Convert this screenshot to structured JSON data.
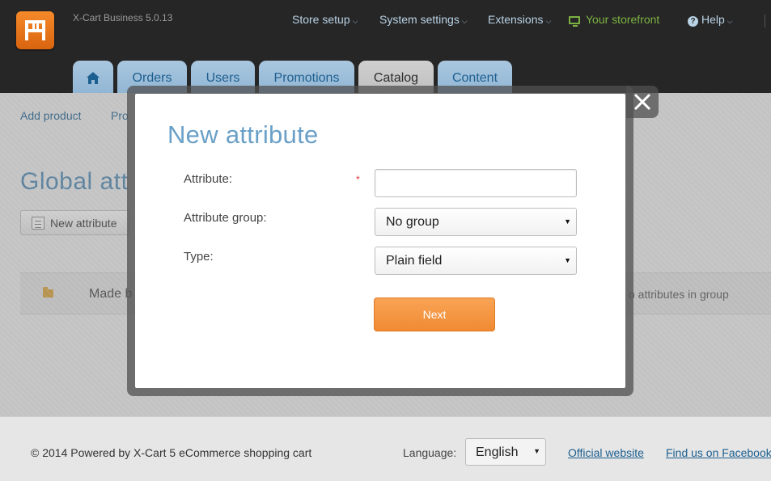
{
  "header": {
    "version": "X-Cart Business 5.0.13",
    "nav": [
      {
        "label": "Store setup",
        "icon": "chevron-down-icon"
      },
      {
        "label": "System settings",
        "icon": "chevron-down-icon"
      },
      {
        "label": "Extensions",
        "icon": "chevron-down-icon"
      },
      {
        "label": "Your storefront",
        "icon": "monitor-icon"
      },
      {
        "label": "Help",
        "icon": "help-icon"
      }
    ],
    "tabs": [
      {
        "label": "",
        "icon": "home-icon"
      },
      {
        "label": "Orders"
      },
      {
        "label": "Users"
      },
      {
        "label": "Promotions"
      },
      {
        "label": "Catalog",
        "active": true
      },
      {
        "label": "Content"
      }
    ]
  },
  "page": {
    "subnav": [
      "Add product",
      "Pro"
    ],
    "title": "Global att",
    "new_attribute_label": "New attribute",
    "group_row": {
      "name": "Made b",
      "count_text": "o attributes in group"
    }
  },
  "modal": {
    "title": "New attribute",
    "fields": {
      "attribute_label": "Attribute:",
      "attribute_value": "",
      "required_mark": "*",
      "group_label": "Attribute group:",
      "group_value": "No group",
      "type_label": "Type:",
      "type_value": "Plain field"
    },
    "next_label": "Next",
    "dropdown_arrow": "▼"
  },
  "footer": {
    "copyright": "© 2014 Powered by X-Cart 5 eCommerce shopping cart",
    "language_label": "Language:",
    "language_value": "English",
    "official_website": "Official website",
    "facebook": "Find us on Facebook"
  },
  "colors": {
    "header_bg": "#262626",
    "tab": "#9fc0dc",
    "accent_orange": "#f39445",
    "title_blue": "#6aa0c8",
    "link_blue": "#1d5f8f",
    "storefront_green": "#7cb342"
  }
}
